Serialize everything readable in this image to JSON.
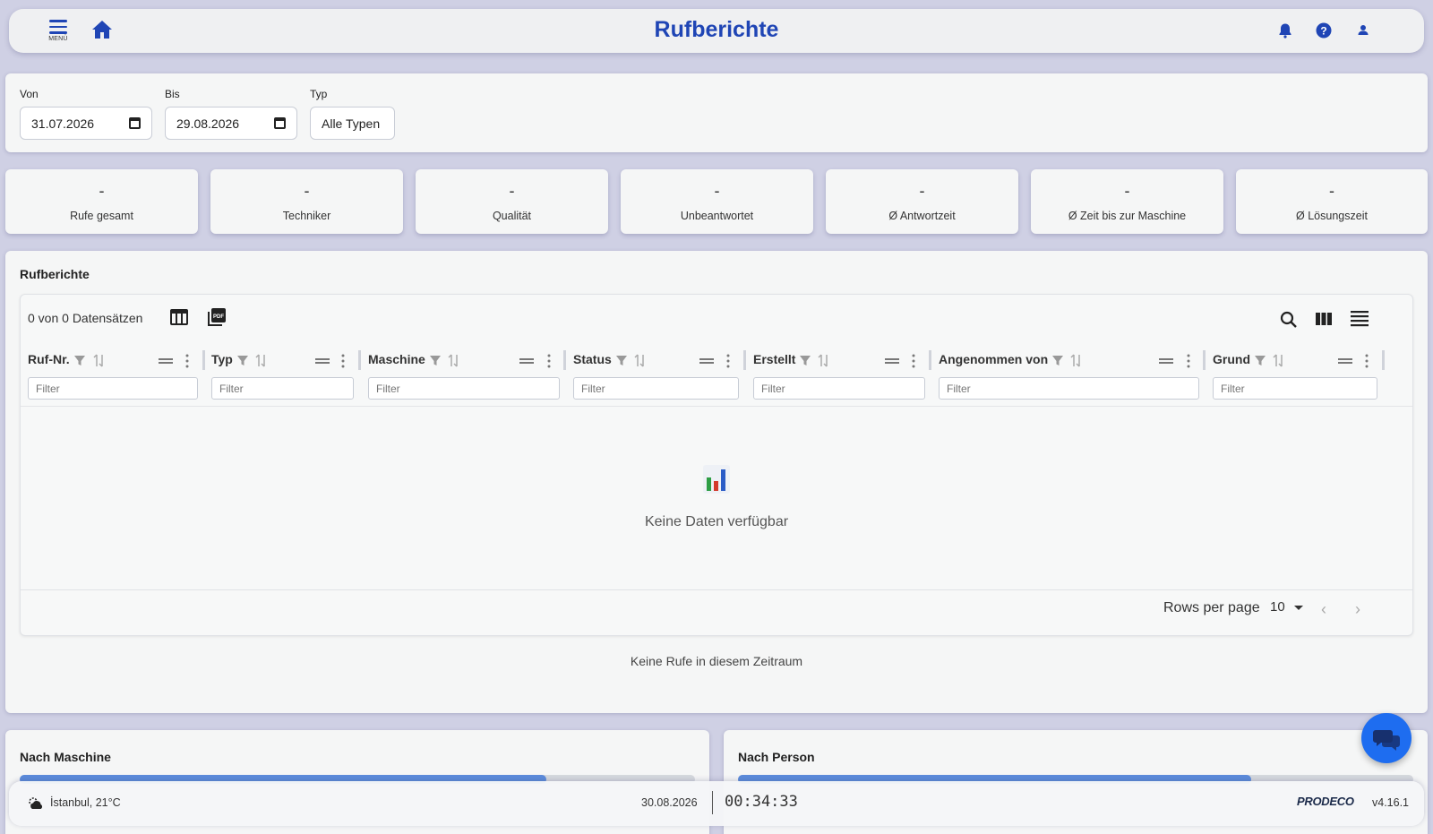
{
  "header": {
    "menu_label": "MENÜ",
    "title": "Rufberichte",
    "icons": [
      "menu-icon",
      "home-icon",
      "bell-icon",
      "help-icon",
      "user-icon"
    ]
  },
  "filters": {
    "from_label": "Von",
    "from_value": "31.07.2026",
    "to_label": "Bis",
    "to_value": "29.08.2026",
    "type_label": "Typ",
    "type_value": "Alle Typen"
  },
  "stats": [
    {
      "value": "-",
      "label": "Rufe gesamt"
    },
    {
      "value": "-",
      "label": "Techniker"
    },
    {
      "value": "-",
      "label": "Qualität"
    },
    {
      "value": "-",
      "label": "Unbeantwortet"
    },
    {
      "value": "-",
      "label": "Ø Antwortzeit"
    },
    {
      "value": "-",
      "label": "Ø Zeit bis zur Maschine"
    },
    {
      "value": "-",
      "label": "Ø Lösungszeit"
    }
  ],
  "reports": {
    "title": "Rufberichte",
    "record_count": "0 von 0 Datensätzen",
    "columns": [
      "Ruf-Nr.",
      "Typ",
      "Maschine",
      "Status",
      "Erstellt",
      "Angenommen von",
      "Grund"
    ],
    "filter_placeholder": "Filter",
    "empty_text": "Keine Daten verfügbar",
    "rows_per_page_label": "Rows per page",
    "rows_per_page_value": "10",
    "no_calls_text": "Keine Rufe in diesem Zeitraum"
  },
  "bottom": {
    "by_machine_title": "Nach Maschine",
    "by_machine_bar_fraction": 0.78,
    "by_person_title": "Nach Person",
    "by_person_bar_fraction": 0.76
  },
  "statusbar": {
    "weather": "İstanbul, 21°C",
    "date": "30.08.2026",
    "time": "00:34:33",
    "brand": "PRODECO",
    "version": "v4.16.1"
  },
  "colors": {
    "accent": "#1f45b5",
    "background": "#cfd0e4",
    "fab": "#1e6df0",
    "bar": "#5c8cdb"
  }
}
